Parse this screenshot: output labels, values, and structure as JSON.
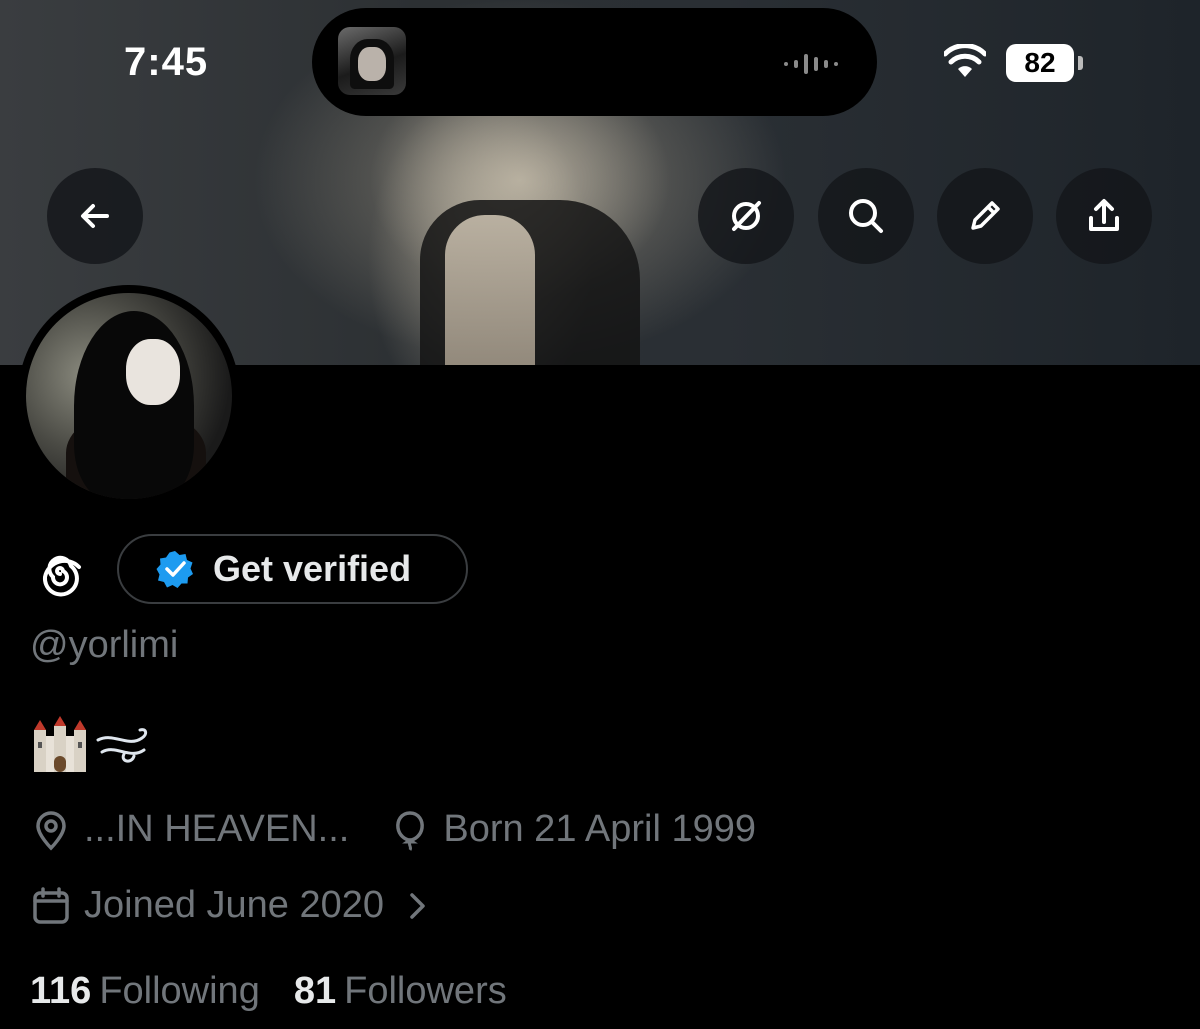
{
  "status_bar": {
    "time": "7:45",
    "battery": "82",
    "icons": [
      "wifi-icon",
      "battery-icon"
    ]
  },
  "header_actions": {
    "back": "back-arrow-icon",
    "grok": "grok-icon",
    "search": "search-icon",
    "edit": "pencil-icon",
    "share": "share-icon"
  },
  "profile": {
    "display_name_icon": "spiral-icon",
    "verify_label": "Get verified",
    "handle": "@yorlimi",
    "bio_emojis": [
      "castle-emoji",
      "wind-emoji"
    ],
    "location": "...IN HEAVEN...",
    "birthday": "Born 21 April 1999",
    "joined": "Joined June 2020",
    "following_count": "116",
    "following_label": "Following",
    "followers_count": "81",
    "followers_label": "Followers"
  },
  "colors": {
    "background": "#000000",
    "text_primary": "#e7e9ea",
    "text_secondary": "#71767b",
    "verified_blue": "#1d9bf0"
  }
}
